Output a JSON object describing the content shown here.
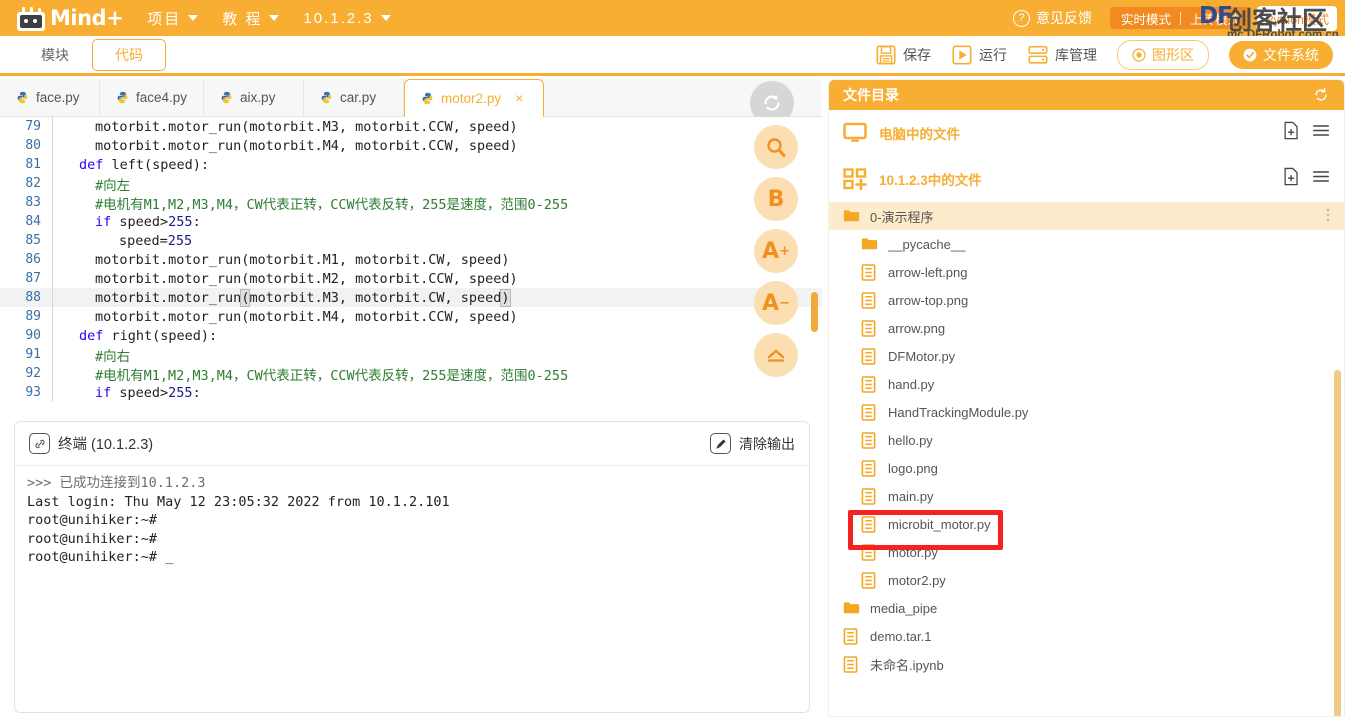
{
  "header": {
    "brand": "Mind+",
    "logo_icon": "mindplus-robot-logo",
    "menus": [
      {
        "label": "项目",
        "icon": "chevron-down-icon"
      },
      {
        "label": "教 程",
        "icon": "chevron-down-icon"
      },
      {
        "label": "10.1.2.3",
        "icon": "chevron-down-icon"
      }
    ],
    "feedback": {
      "label": "意见反馈",
      "icon": "question-circle-icon"
    },
    "modes": [
      {
        "label": "实时模式"
      },
      {
        "label": "上传模式"
      }
    ],
    "python_mode": "Python模式",
    "watermark": {
      "df": "DF",
      "title": "创客社区",
      "url": "mc.DFRobot.com.cn"
    },
    "colors": {
      "brand_orange": "#F7AE32",
      "deep_orange": "#F18A21"
    }
  },
  "toolbar": {
    "tabs": [
      {
        "label": "模块",
        "active": false
      },
      {
        "label": "代码",
        "active": true
      }
    ],
    "buttons": [
      {
        "label": "保存",
        "icon": "save-disk-icon"
      },
      {
        "label": "运行",
        "icon": "play-run-icon"
      },
      {
        "label": "库管理",
        "icon": "library-stack-icon"
      }
    ],
    "pills": [
      {
        "label": "图形区",
        "icon": "target-circle-icon",
        "style": "outline"
      },
      {
        "label": "文件系统",
        "icon": "check-circle-icon",
        "style": "solid"
      }
    ]
  },
  "file_tabs": {
    "items": [
      {
        "label": "face.py",
        "active": false
      },
      {
        "label": "face4.py",
        "active": false
      },
      {
        "label": "aix.py",
        "active": false
      },
      {
        "label": "car.py",
        "active": false
      },
      {
        "label": "motor2.py",
        "active": true,
        "close": "×"
      }
    ],
    "refresh_icon": "refresh-circle-icon"
  },
  "side_actions": [
    {
      "label": "Q",
      "name": "search-icon"
    },
    {
      "label": "B",
      "name": "bold-icon"
    },
    {
      "label": "A",
      "sup": "+",
      "name": "font-increase-icon"
    },
    {
      "label": "A",
      "sup": "−",
      "name": "font-decrease-icon"
    },
    {
      "label": "⌃",
      "name": "collapse-up-icon"
    }
  ],
  "editor": {
    "lines": [
      {
        "n": "79",
        "indent": 4,
        "parts": [
          {
            "t": "plain",
            "s": "motorbit.motor_run(motorbit.M3, motorbit.CCW, speed)"
          }
        ]
      },
      {
        "n": "80",
        "indent": 4,
        "parts": [
          {
            "t": "plain",
            "s": "motorbit.motor_run(motorbit.M4, motorbit.CCW, speed)"
          }
        ]
      },
      {
        "n": "81",
        "indent": 2,
        "parts": [
          {
            "t": "kw",
            "s": "def"
          },
          {
            "t": "plain",
            "s": " left(speed):"
          }
        ]
      },
      {
        "n": "82",
        "indent": 4,
        "parts": [
          {
            "t": "comment",
            "s": "#向左"
          }
        ]
      },
      {
        "n": "83",
        "indent": 4,
        "parts": [
          {
            "t": "comment",
            "s": "#电机有M1,M2,M3,M4，CW代表正转，CCW代表反转，255是速度，范围0-255"
          }
        ]
      },
      {
        "n": "84",
        "indent": 4,
        "parts": [
          {
            "t": "kw",
            "s": "if"
          },
          {
            "t": "plain",
            "s": " speed>"
          },
          {
            "t": "num",
            "s": "255"
          },
          {
            "t": "plain",
            "s": ":"
          }
        ]
      },
      {
        "n": "85",
        "indent": 7,
        "parts": [
          {
            "t": "plain",
            "s": "speed="
          },
          {
            "t": "num",
            "s": "255"
          }
        ]
      },
      {
        "n": "86",
        "indent": 4,
        "parts": [
          {
            "t": "plain",
            "s": "motorbit.motor_run(motorbit.M1, motorbit.CW, speed)"
          }
        ]
      },
      {
        "n": "87",
        "indent": 4,
        "parts": [
          {
            "t": "plain",
            "s": "motorbit.motor_run(motorbit.M2, motorbit.CCW, speed)"
          }
        ]
      },
      {
        "n": "88",
        "indent": 4,
        "active": true,
        "parts": [
          {
            "t": "plain",
            "s": "motorbit.motor_run"
          },
          {
            "t": "bracket",
            "s": "("
          },
          {
            "t": "plain",
            "s": "motorbit.M3, motorbit.CW, speed"
          },
          {
            "t": "bracket",
            "s": ")"
          }
        ]
      },
      {
        "n": "89",
        "indent": 4,
        "parts": [
          {
            "t": "plain",
            "s": "motorbit.motor_run(motorbit.M4, motorbit.CCW, speed)"
          }
        ]
      },
      {
        "n": "90",
        "indent": 2,
        "parts": [
          {
            "t": "kw",
            "s": "def"
          },
          {
            "t": "plain",
            "s": " right(speed):"
          }
        ]
      },
      {
        "n": "91",
        "indent": 4,
        "parts": [
          {
            "t": "comment",
            "s": "#向右"
          }
        ]
      },
      {
        "n": "92",
        "indent": 4,
        "parts": [
          {
            "t": "comment",
            "s": "#电机有M1,M2,M3,M4，CW代表正转，CCW代表反转，255是速度，范围0-255"
          }
        ]
      },
      {
        "n": "93",
        "indent": 4,
        "parts": [
          {
            "t": "kw",
            "s": "if"
          },
          {
            "t": "plain",
            "s": " speed>"
          },
          {
            "t": "num",
            "s": "255"
          },
          {
            "t": "plain",
            "s": ":"
          }
        ]
      }
    ]
  },
  "terminal": {
    "title": "终端 (10.1.2.3)",
    "title_icon": "link-chain-icon",
    "clear_label": "清除输出",
    "clear_icon": "brush-clear-icon",
    "output": [
      ">>> 已成功连接到10.1.2.3",
      "Last login: Thu May 12 23:05:32 2022 from 10.1.2.101",
      "root@unihiker:~#",
      "root@unihiker:~#",
      "root@unihiker:~# _"
    ]
  },
  "file_panel": {
    "title": "文件目录",
    "refresh_icon": "refresh-icon",
    "sections": [
      {
        "label": "电脑中的文件",
        "icon": "monitor-icon",
        "actions": [
          "new-file-icon",
          "menu-icon"
        ]
      },
      {
        "label": "10.1.2.3中的文件",
        "icon": "board-grid-icon",
        "actions": [
          "new-file-icon",
          "menu-icon"
        ]
      }
    ],
    "tree": [
      {
        "label": "0-演示程序",
        "type": "folder",
        "indent": 0,
        "selected": true,
        "menu": "kebab-menu-icon"
      },
      {
        "label": "__pycache__",
        "type": "folder",
        "indent": 1
      },
      {
        "label": "arrow-left.png",
        "type": "file",
        "indent": 1
      },
      {
        "label": "arrow-top.png",
        "type": "file",
        "indent": 1
      },
      {
        "label": "arrow.png",
        "type": "file",
        "indent": 1
      },
      {
        "label": "DFMotor.py",
        "type": "file",
        "indent": 1
      },
      {
        "label": "hand.py",
        "type": "file",
        "indent": 1
      },
      {
        "label": "HandTrackingModule.py",
        "type": "file",
        "indent": 1
      },
      {
        "label": "hello.py",
        "type": "file",
        "indent": 1
      },
      {
        "label": "logo.png",
        "type": "file",
        "indent": 1
      },
      {
        "label": "main.py",
        "type": "file",
        "indent": 1
      },
      {
        "label": "microbit_motor.py",
        "type": "file",
        "indent": 1,
        "highlighted": true
      },
      {
        "label": "motor.py",
        "type": "file",
        "indent": 1
      },
      {
        "label": "motor2.py",
        "type": "file",
        "indent": 1
      },
      {
        "label": "media_pipe",
        "type": "folder",
        "indent": 0
      },
      {
        "label": "demo.tar.1",
        "type": "file",
        "indent": 0
      },
      {
        "label": "未命名.ipynb",
        "type": "file",
        "indent": 0
      }
    ],
    "annotation": {
      "color": "#F42222",
      "target": "microbit_motor.py"
    }
  }
}
